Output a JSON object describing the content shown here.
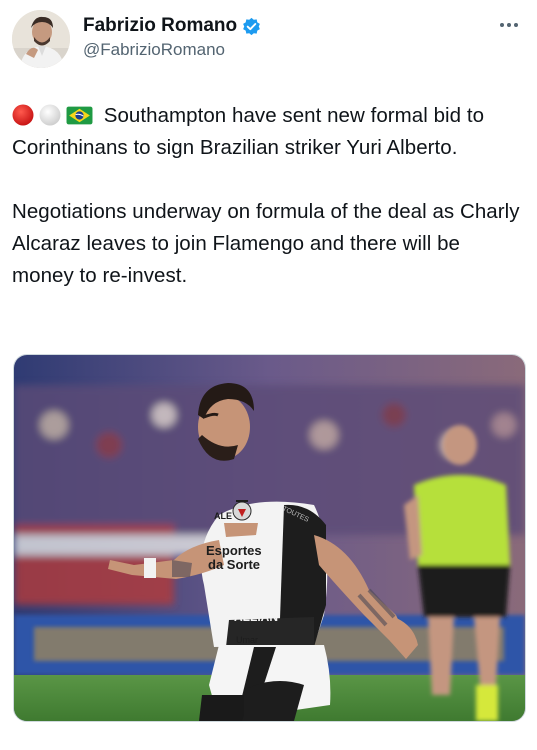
{
  "author": {
    "display_name": "Fabrizio Romano",
    "handle": "@FabrizioRomano",
    "verified": true,
    "avatar_icon": "profile-photo"
  },
  "more_icon": "more-horizontal-icon",
  "tweet": {
    "emojis": [
      "red-circle",
      "white-circle",
      "brazil-flag"
    ],
    "paragraph_1": "Southampton have sent new formal bid to Corinthinans to sign Brazilian striker Yuri Alberto.",
    "paragraph_2": "Negotiations underway on formula of the deal as Charly Alcaraz leaves to join Flamengo and there will be money to re-invest."
  },
  "media": {
    "kind": "photo",
    "shirt_sponsor": "Esportes\nda Sorte",
    "colors": {
      "pitch": "#4f8a3c",
      "crowd": "#3f4c7a",
      "referee_shirt": "#b8e23a",
      "jersey": "#f4f4f4"
    }
  },
  "colors": {
    "text": "#0f1419",
    "secondary": "#536471",
    "verified_blue": "#1d9bf0",
    "border": "#cfd9de"
  }
}
